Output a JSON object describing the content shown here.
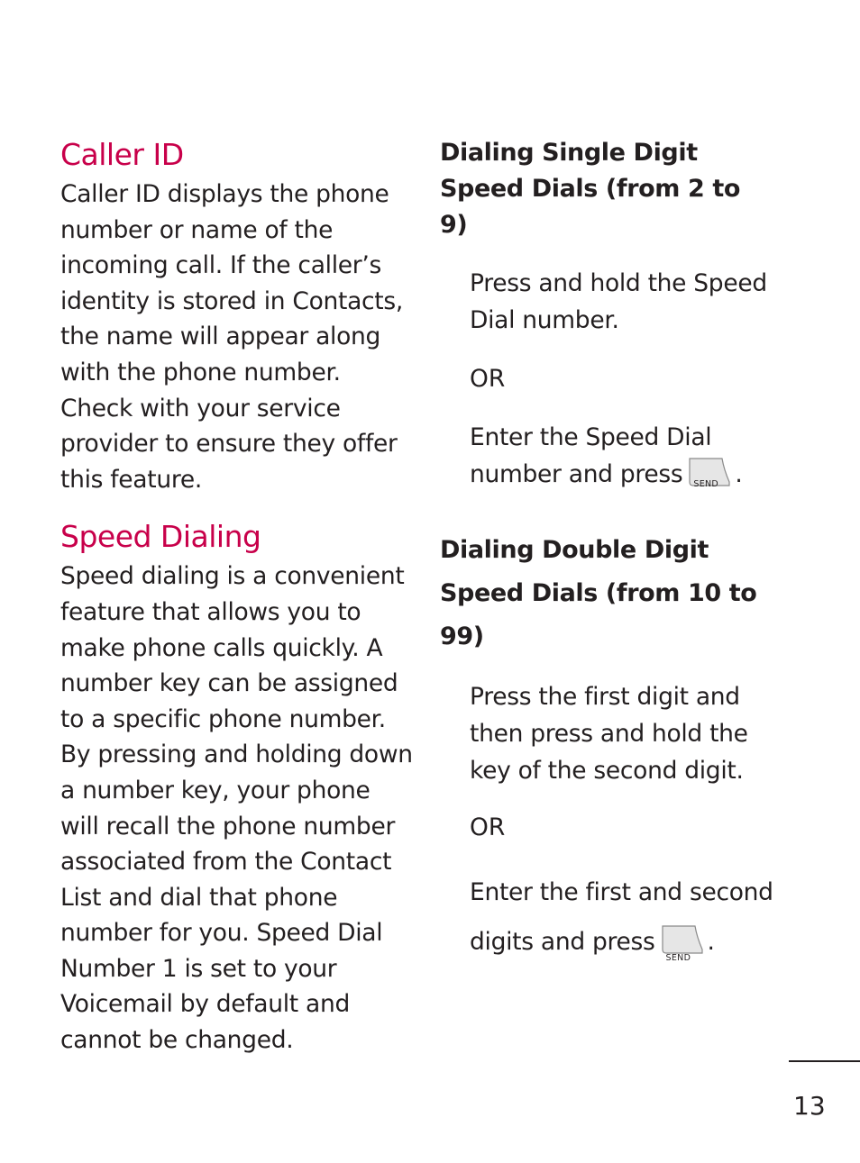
{
  "left": {
    "caller_id": {
      "heading": "Caller ID",
      "body": "Caller ID displays the phone number or name of the incoming call. If the caller’s identity is stored in Contacts, the name will appear along with the phone number. Check with your service provider to ensure they offer this feature."
    },
    "speed_dialing": {
      "heading": "Speed Dialing",
      "body": "Speed dialing is a convenient feature that allows you to make phone calls quickly. A number key can be assigned to a specific phone number. By pressing and holding down a number key, your phone will recall the phone number associated from the Contact List and dial that phone number for you. Speed Dial Number 1 is set to your Voicemail by default and cannot be changed."
    }
  },
  "right": {
    "single": {
      "heading": "Dialing Single Digit Speed Dials (from 2 to 9)",
      "step1": "Press and hold the Speed Dial number.",
      "or": "OR",
      "step2": "Enter the Speed Dial number and press",
      "step2_end": "."
    },
    "double": {
      "heading": "Dialing Double Digit Speed Dials (from 10 to 99)",
      "step1": "Press the first digit and then press and hold the key of the second digit.",
      "or": "OR",
      "step2": "Enter the first and second digits and press",
      "step2_end": "."
    },
    "send_key_label": "SEND",
    "send_key_icon": "send-key-icon"
  },
  "footer": {
    "page_number": "13"
  }
}
